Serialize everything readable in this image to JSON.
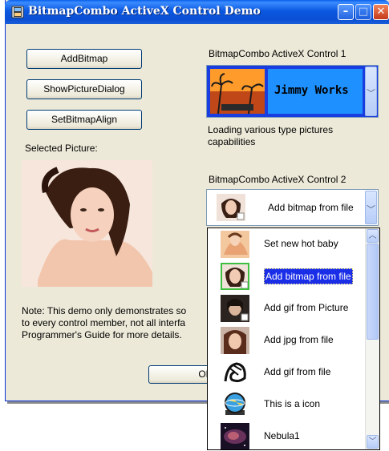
{
  "window": {
    "title": "BitmapCombo ActiveX Control Demo",
    "min_glyph": "–",
    "max_glyph": "□",
    "close_glyph": "✕"
  },
  "buttons": {
    "add_bitmap": "AddBitmap",
    "show_picture_dialog": "ShowPictureDialog",
    "set_bitmap_align": "SetBitmapAlign",
    "ok": "OK"
  },
  "selected_picture_label": "Selected Picture:",
  "control1": {
    "label": "BitmapCombo ActiveX Control 1",
    "selected_text": "Jimmy Works",
    "description_line1": "Loading various type pictures",
    "description_line2": "capabilities"
  },
  "control2": {
    "label": "BitmapCombo ActiveX Control 2",
    "selected_text": "Add bitmap from file",
    "items": [
      {
        "label": "Set new hot baby",
        "icon": "portrait-icon"
      },
      {
        "label": "Add bitmap from file",
        "icon": "portrait-icon",
        "selected": true
      },
      {
        "label": "Add gif from Picture",
        "icon": "portrait-icon"
      },
      {
        "label": "Add jpg from file",
        "icon": "portrait-icon"
      },
      {
        "label": "Add gif from file",
        "icon": "sketch-icon"
      },
      {
        "label": "This is a icon",
        "icon": "globe-icon"
      },
      {
        "label": "Nebula1",
        "icon": "nebula-icon"
      }
    ]
  },
  "note": {
    "line1": "Note: This demo only demonstrates so",
    "line2": "to every control member, not all interfa",
    "line3": "Programmer's Guide for more details."
  },
  "colors": {
    "titlebar": "#0a4fd4",
    "window_bg": "#ece9d8",
    "selection": "#1a2ee8",
    "combo1_bg": "#1e90ff"
  }
}
